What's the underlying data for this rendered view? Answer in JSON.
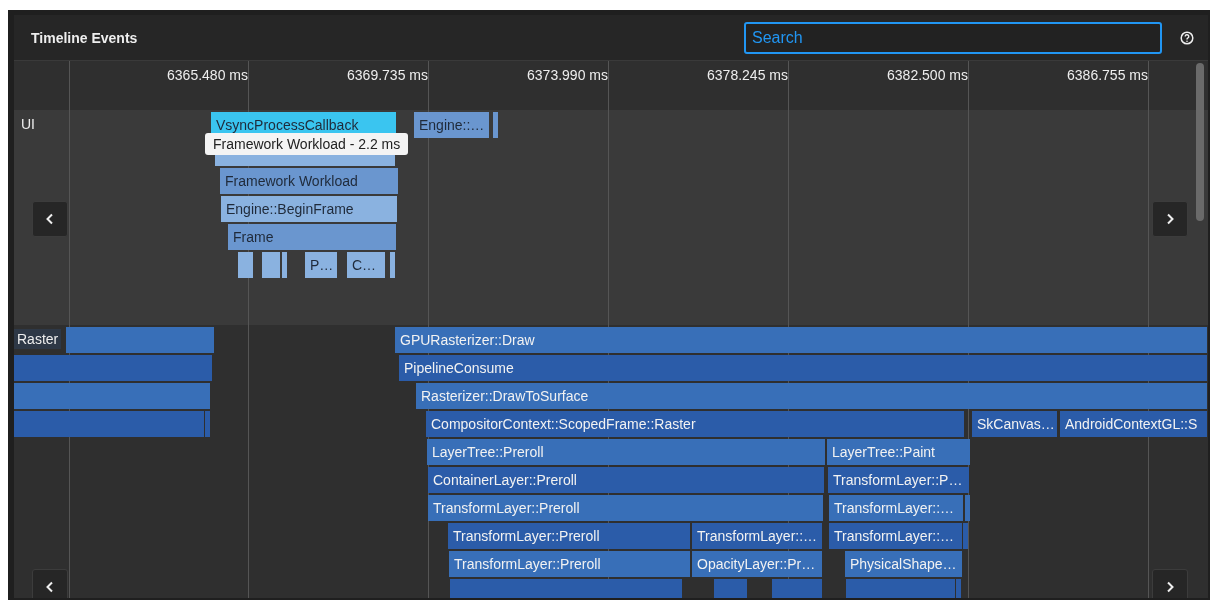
{
  "panel": {
    "title": "Timeline Events",
    "search": {
      "placeholder": "Search"
    }
  },
  "ruler": [
    "6365.480 ms",
    "6369.735 ms",
    "6373.990 ms",
    "6378.245 ms",
    "6382.500 ms",
    "6386.755 ms"
  ],
  "lanes": [
    {
      "name": "UI",
      "events": [
        {
          "label": "VsyncProcessCallback",
          "selected": true
        },
        {
          "label": "Engine::…",
          "selected": false
        },
        {
          "selected": false
        },
        {
          "selected": false
        },
        {
          "label": "Framework Workload",
          "selected": false
        },
        {
          "label": "Engine::BeginFrame",
          "selected": false
        },
        {
          "label": "Frame",
          "selected": false
        },
        {
          "selected": false
        },
        {
          "selected": false
        },
        {
          "selected": false
        },
        {
          "label": "P…",
          "selected": false
        },
        {
          "label": "C…",
          "selected": false
        },
        {
          "selected": false
        }
      ]
    },
    {
      "name": "Raster",
      "events": [
        {
          "selected": false
        },
        {
          "label": "GPURasterizer::Draw",
          "selected": false
        },
        {
          "selected": false
        },
        {
          "label": "PipelineConsume",
          "selected": false
        },
        {
          "selected": false
        },
        {
          "label": "Rasterizer::DrawToSurface",
          "selected": false
        },
        {
          "selected": false
        },
        {
          "selected": false
        },
        {
          "label": "CompositorContext::ScopedFrame::Raster",
          "selected": false
        },
        {
          "label": "SkCanvas…",
          "selected": false
        },
        {
          "label": "AndroidContextGL::S",
          "selected": false
        },
        {
          "label": "LayerTree::Preroll",
          "selected": false
        },
        {
          "label": "LayerTree::Paint",
          "selected": false
        },
        {
          "label": "ContainerLayer::Preroll",
          "selected": false
        },
        {
          "label": "TransformLayer::P…",
          "selected": false
        },
        {
          "label": "TransformLayer::Preroll",
          "selected": false
        },
        {
          "label": "TransformLayer::…",
          "selected": false
        },
        {
          "selected": false
        },
        {
          "label": "TransformLayer::Preroll",
          "selected": false
        },
        {
          "label": "TransformLayer::…",
          "selected": false
        },
        {
          "label": "TransformLayer::…",
          "selected": false
        },
        {
          "selected": false
        },
        {
          "label": "TransformLayer::Preroll",
          "selected": false
        },
        {
          "label": "OpacityLayer::Pr…",
          "selected": false
        },
        {
          "label": "PhysicalShape…",
          "selected": false
        },
        {
          "selected": false
        },
        {
          "selected": false
        },
        {
          "selected": false
        },
        {
          "selected": false
        },
        {
          "selected": false
        }
      ]
    }
  ],
  "tooltip": "Framework Workload - 2.2 ms"
}
